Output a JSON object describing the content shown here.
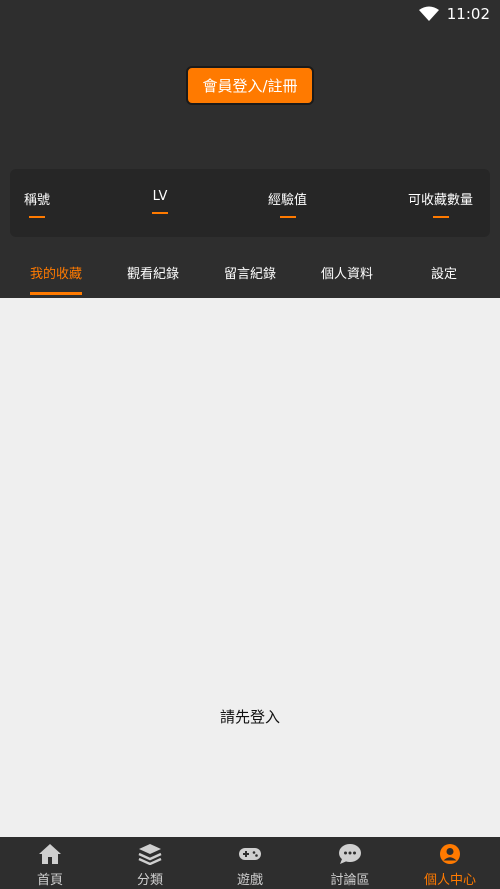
{
  "status_bar": {
    "time": "11:02",
    "icon": "wifi-icon"
  },
  "header": {
    "login_button_label": "會員登入/註冊"
  },
  "stats": [
    {
      "label": "稱號"
    },
    {
      "label": "LV"
    },
    {
      "label": "經驗值"
    },
    {
      "label": "可收藏數量"
    }
  ],
  "tabs": [
    {
      "label": "我的收藏",
      "active": true
    },
    {
      "label": "觀看紀錄"
    },
    {
      "label": "留言紀錄"
    },
    {
      "label": "個人資料"
    },
    {
      "label": "設定"
    }
  ],
  "main": {
    "empty_message": "請先登入"
  },
  "bottom_nav": [
    {
      "label": "首頁",
      "icon": "home-icon"
    },
    {
      "label": "分類",
      "icon": "layers-icon"
    },
    {
      "label": "遊戲",
      "icon": "gamepad-icon"
    },
    {
      "label": "討論區",
      "icon": "chat-icon"
    },
    {
      "label": "個人中心",
      "icon": "user-icon",
      "active": true
    }
  ],
  "colors": {
    "accent": "#ff7a00",
    "dark_bg": "#2e2e2e",
    "content_bg": "#efefef"
  }
}
